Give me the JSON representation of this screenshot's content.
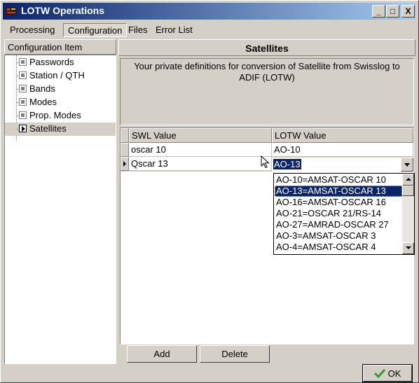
{
  "window": {
    "title": "LOTW Operations",
    "minimize_label": "_",
    "maximize_label": "□",
    "close_label": "X"
  },
  "menu": [
    {
      "label": "Processing"
    },
    {
      "label": "Configuration"
    },
    {
      "label": "Files"
    },
    {
      "label": "Error List"
    }
  ],
  "left_panel": {
    "header": "Configuration Item",
    "items": [
      {
        "label": "Passwords"
      },
      {
        "label": "Station / QTH"
      },
      {
        "label": "Bands"
      },
      {
        "label": "Modes"
      },
      {
        "label": "Prop. Modes"
      },
      {
        "label": "Satellites"
      }
    ]
  },
  "main": {
    "header": "Satellites",
    "description": "Your private definitions for conversion of Satellite from Swisslog to ADIF (LOTW)",
    "grid": {
      "columns": [
        "SWL Value",
        "LOTW Value"
      ],
      "rows": [
        {
          "swl": "oscar 10",
          "lotw": "AO-10"
        },
        {
          "swl": "Qscar 13",
          "lotw": "AO-13"
        }
      ]
    },
    "dropdown": {
      "options": [
        "AO-10=AMSAT-OSCAR 10",
        "AO-13=AMSAT-OSCAR 13",
        "AO-16=AMSAT-OSCAR 16",
        "AO-21=OSCAR 21/RS-14",
        "AO-27=AMRAD-OSCAR 27",
        "AO-3=AMSAT-OSCAR 3",
        "AO-4=AMSAT-OSCAR 4"
      ],
      "selected_index": 1
    },
    "buttons": {
      "add": "Add",
      "delete": "Delete"
    }
  },
  "footer": {
    "ok": "OK"
  },
  "colors": {
    "accent": "#0a246a",
    "face": "#d4d0c8",
    "ok_check": "#2f9e2f"
  }
}
